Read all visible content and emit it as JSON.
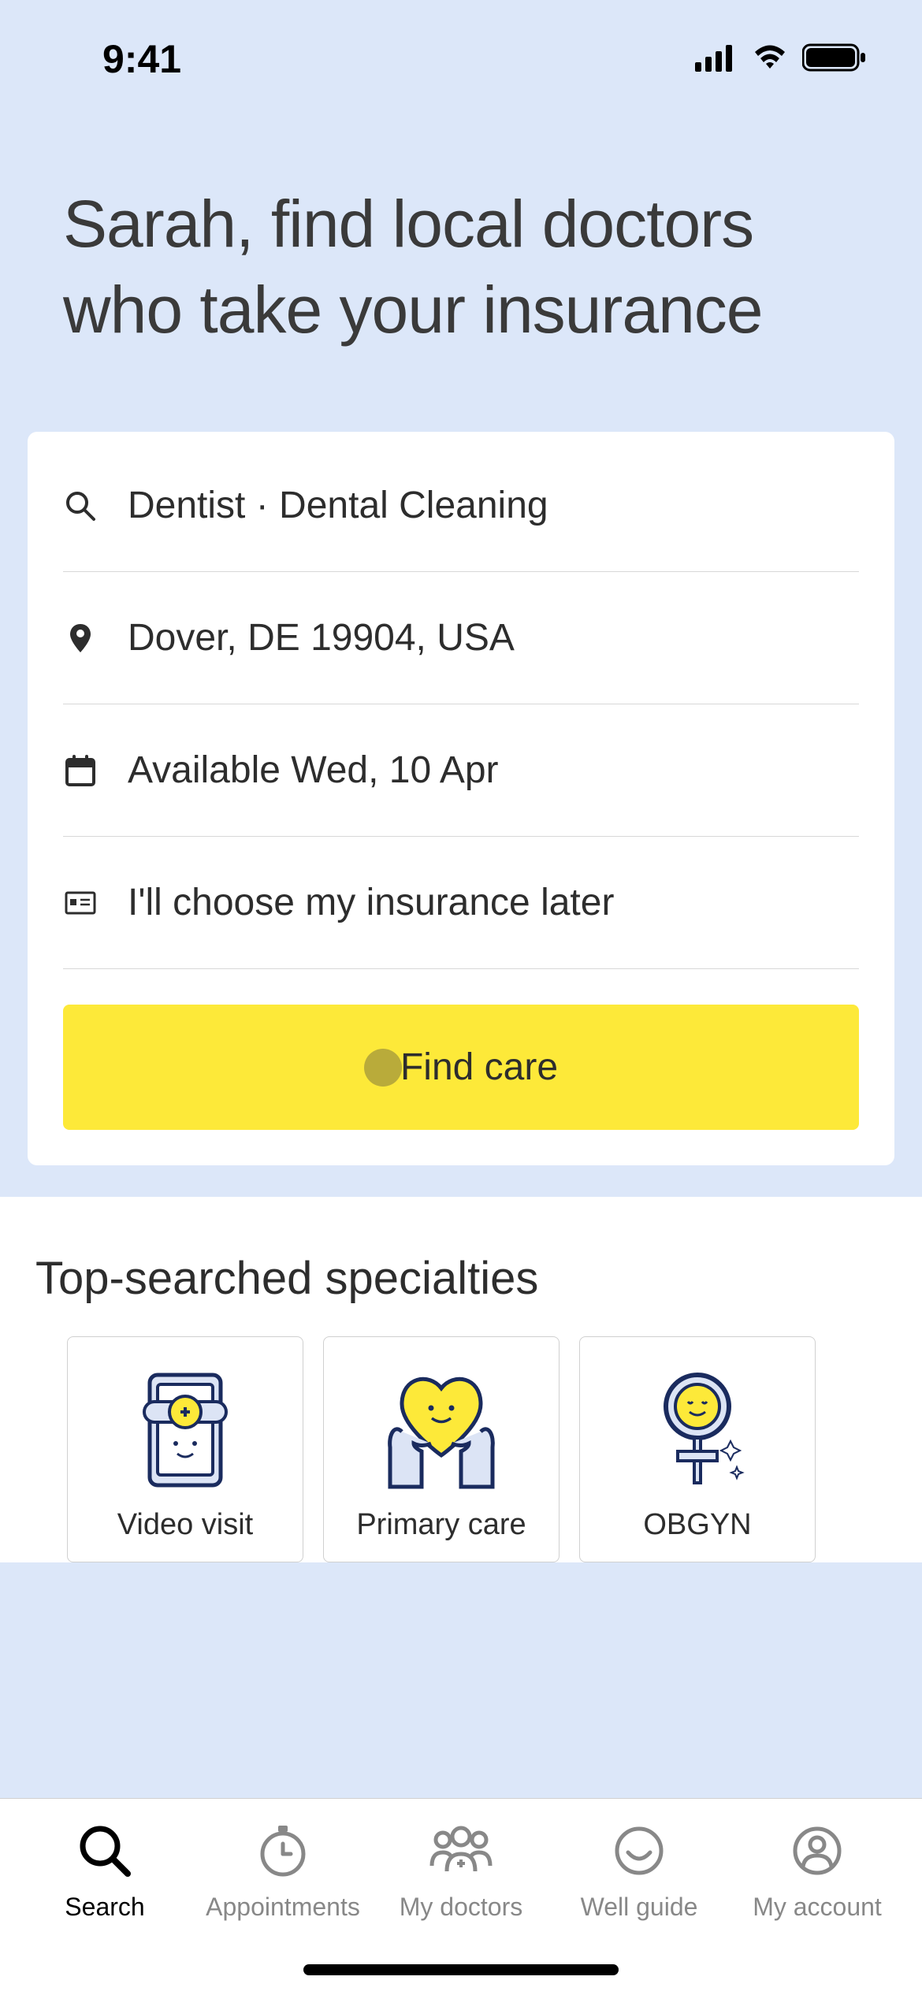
{
  "statusBar": {
    "time": "9:41"
  },
  "heading": "Sarah, find local doctors who take your insurance",
  "searchCard": {
    "query": "Dentist · Dental Cleaning",
    "location": "Dover, DE 19904, USA",
    "date": "Available Wed, 10 Apr",
    "insurance": "I'll choose my insurance later",
    "button": "Find care"
  },
  "specialties": {
    "title": "Top-searched specialties",
    "items": [
      {
        "label": "Video visit"
      },
      {
        "label": "Primary care"
      },
      {
        "label": "OBGYN"
      }
    ]
  },
  "tabBar": {
    "items": [
      {
        "label": "Search",
        "active": true
      },
      {
        "label": "Appointments",
        "active": false
      },
      {
        "label": "My doctors",
        "active": false
      },
      {
        "label": "Well guide",
        "active": false
      },
      {
        "label": "My account",
        "active": false
      }
    ]
  }
}
